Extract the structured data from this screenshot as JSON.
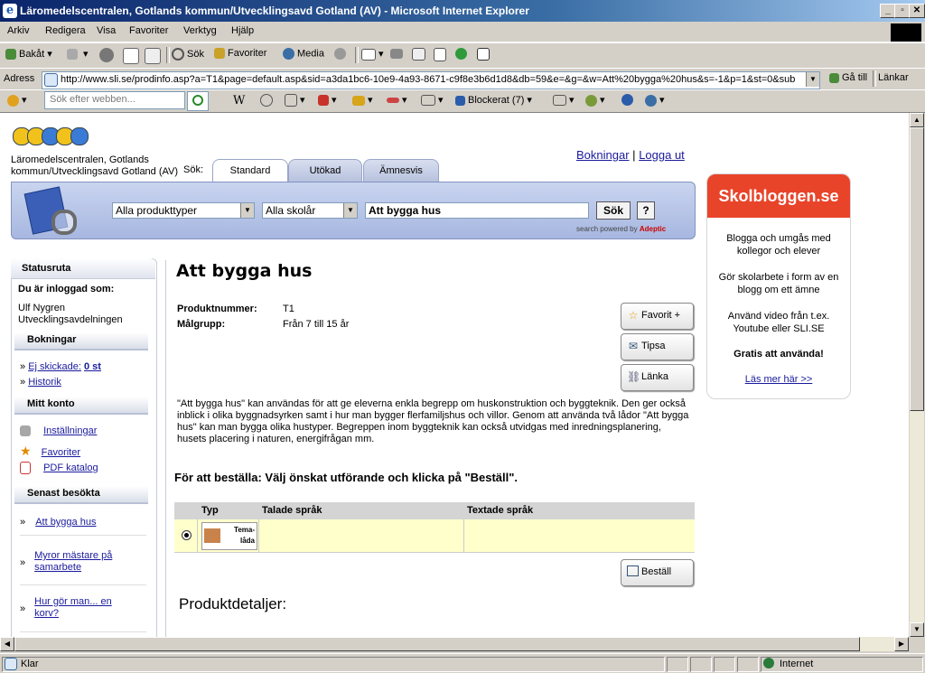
{
  "window": {
    "title": "Läromedelscentralen, Gotlands kommun/Utvecklingsavd Gotland (AV) - Microsoft Internet Explorer"
  },
  "menu": [
    "Arkiv",
    "Redigera",
    "Visa",
    "Favoriter",
    "Verktyg",
    "Hjälp"
  ],
  "toolbar": {
    "back": "Bakåt",
    "search": "Sök",
    "favorites": "Favoriter",
    "media": "Media"
  },
  "address": {
    "label": "Adress",
    "url": "http://www.sli.se/prodinfo.asp?a=T1&page=default.asp&sid=a3da1bc6-10e9-4a93-8671-c9f8e3b6d1d8&db=59&e=&g=&w=Att%20bygga%20hus&s=-1&p=1&st=0&sub",
    "go": "Gå till",
    "links": "Länkar"
  },
  "google_bar": {
    "placeholder": "Sök efter webben...",
    "blocked": "Blockerat (7)"
  },
  "header": {
    "org": "Läromedelscentralen, Gotlands kommun/Utvecklingsavd Gotland (AV)",
    "search_label": "Sök:",
    "tabs": [
      "Standard",
      "Utökad",
      "Ämnesvis"
    ],
    "bookings_link": "Bokningar",
    "link_sep": "|",
    "logout_link": "Logga ut",
    "product_type": "Alla produkttyper",
    "school_year": "Alla skolår",
    "query": "Att bygga hus",
    "search_button": "Sök",
    "help_button": "?",
    "powered_by": "search powered by",
    "powered_brand": "Adeptic"
  },
  "sidebar": {
    "status_title": "Statusruta",
    "logged_in_label": "Du är inloggad som:",
    "user_name": "Ulf Nygren",
    "user_dept": "Utvecklingsavdelningen",
    "bookings_title": "Bokningar",
    "not_sent_label": "Ej skickade:",
    "not_sent_count": "0 st",
    "history": "Historik",
    "account_title": "Mitt konto",
    "settings": "Inställningar",
    "favorites": "Favoriter",
    "pdf_catalog": "PDF katalog",
    "recent_title": "Senast besökta",
    "recent": [
      "Att bygga hus",
      "Myror mästare på samarbete",
      "Hur gör man... en korv?"
    ]
  },
  "product": {
    "title": "Att bygga hus",
    "number_label": "Produktnummer:",
    "number": "T1",
    "audience_label": "Målgrupp:",
    "audience": "Från 7 till 15 år",
    "favorite_button": "Favorit +",
    "tip_button": "Tipsa",
    "link_button": "Länka",
    "description": "\"Att bygga hus\" kan användas för att ge eleverna enkla begrepp om huskonstruktion och byggteknik. Den ger också inblick i olika byggnadsyrken samt i hur man bygger flerfamiljshus och villor. Genom att använda två lådor \"Att bygga hus\" kan man bygga olika hustyper. Begreppen inom byggteknik kan också utvidgas med inredningsplanering, husets placering i naturen, energifrågan mm.",
    "order_instruction": "För att beställa: Välj önskat utförande och klicka på \"Beställ\".",
    "table_headers": [
      "Typ",
      "Talade språk",
      "Textade språk"
    ],
    "table_rows": [
      {
        "type": "Tema-låda",
        "spoken": "",
        "subtitled": ""
      }
    ],
    "order_button": "Beställ",
    "details_title": "Produktdetaljer:"
  },
  "ad": {
    "brand": "Skolbloggen.se",
    "line1": "Blogga och umgås med kollegor och elever",
    "line2": "Gör skolarbete i form av en blogg om ett ämne",
    "line3": "Använd video från t.ex. Youtube eller SLI.SE",
    "free": "Gratis att använda!",
    "more": "Läs mer här >>"
  },
  "status": {
    "text": "Klar",
    "zone": "Internet"
  },
  "colors": {
    "accent": "#e8442a",
    "nav_blue": "#1a1a9e",
    "table_row": "#ffffcc"
  }
}
